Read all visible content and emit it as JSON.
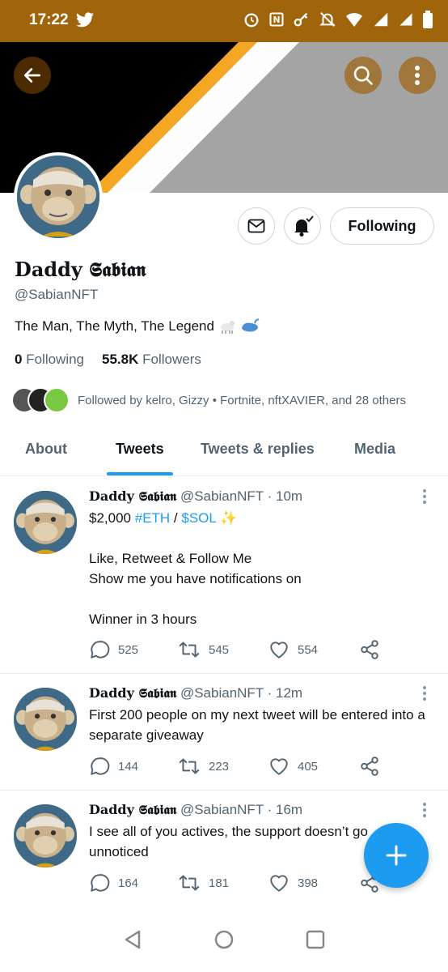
{
  "status": {
    "time": "17:22"
  },
  "profile": {
    "name": "Daddy 𝕾𝖆𝖇𝖎𝖆𝖓",
    "handle": "@SabianNFT",
    "bio": "The Man, The Myth, The Legend",
    "following_count": "0",
    "following_label": "Following",
    "followers_count": "55.8K",
    "followers_label": "Followers",
    "followed_by": "Followed by kelro, Gizzy • Fortnite, nftXAVIER, and 28 others",
    "following_button": "Following"
  },
  "tabs": [
    {
      "label": "About"
    },
    {
      "label": "Tweets"
    },
    {
      "label": "Tweets & replies"
    },
    {
      "label": "Media"
    }
  ],
  "active_tab": "Tweets",
  "tweets": [
    {
      "author": "Daddy 𝕾𝖆𝖇𝖎𝖆𝖓",
      "handle": "@SabianNFT",
      "time": "· 10m",
      "text_prefix": "$2,000 ",
      "hashtag": "#ETH",
      "text_mid": " / ",
      "cashtag": "$SOL",
      "text_rest": "Like, Retweet & Follow Me\nShow me you have notifications on\n\nWinner in 3 hours",
      "replies": "525",
      "retweets": "545",
      "likes": "554"
    },
    {
      "author": "Daddy 𝕾𝖆𝖇𝖎𝖆𝖓",
      "handle": "@SabianNFT",
      "time": "· 12m",
      "text": "First 200 people on my next tweet will be entered into a separate giveaway",
      "replies": "144",
      "retweets": "223",
      "likes": "405"
    },
    {
      "author": "Daddy 𝕾𝖆𝖇𝖎𝖆𝖓",
      "handle": "@SabianNFT",
      "time": "· 16m",
      "text": "I see all of you actives, the support doesn’t go unnoticed",
      "replies": "164",
      "retweets": "181",
      "likes": "398"
    }
  ],
  "colors": {
    "status_bar": "#a0640a",
    "accent": "#1d9bf0",
    "banner_orange": "#f5a623",
    "avatar_bg": "#3e6a87"
  },
  "icons": [
    "back-arrow-icon",
    "search-icon",
    "more-vertical-icon",
    "mail-icon",
    "bell-check-icon",
    "reply-icon",
    "retweet-icon",
    "like-icon",
    "share-icon",
    "compose-plus-icon"
  ]
}
